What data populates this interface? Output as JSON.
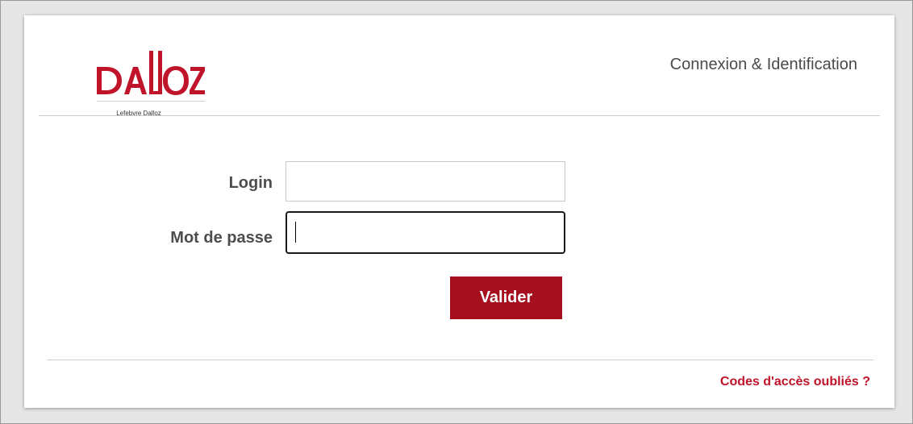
{
  "brand": {
    "logo_text": "DALLOZ",
    "tagline": "Lefebvre Dalloz",
    "color": "#c0142a"
  },
  "header": {
    "title": "Connexion & Identification"
  },
  "form": {
    "login_label": "Login",
    "login_value": "",
    "password_label": "Mot de passe",
    "password_value": "",
    "submit_label": "Valider",
    "submit_color": "#a50f1e"
  },
  "footer": {
    "forgot_link": "Codes d'accès oubliés ?",
    "link_color": "#c0142a"
  }
}
